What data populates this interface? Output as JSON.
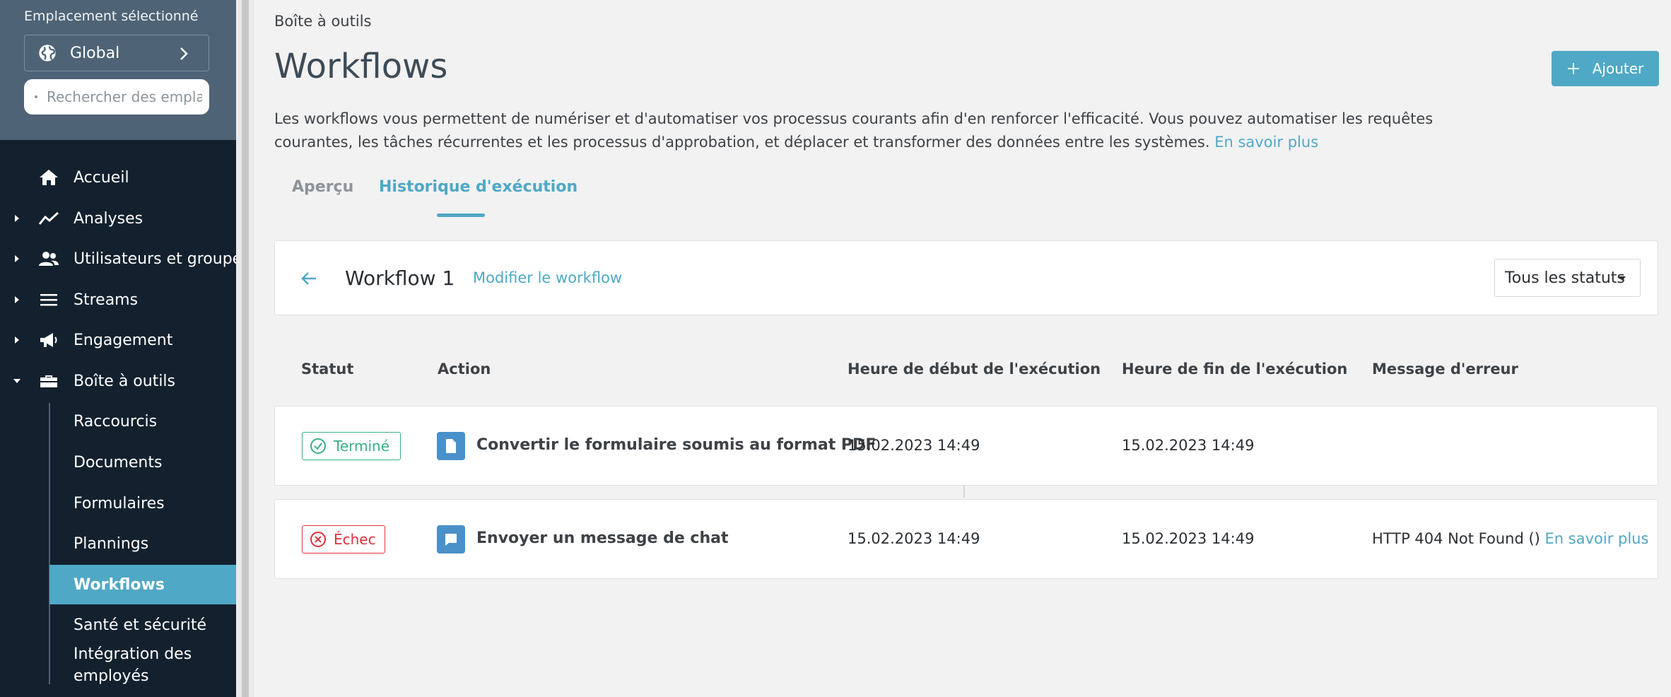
{
  "sidebar": {
    "location_label": "Emplacement sélectionné",
    "location_value": "Global",
    "search_placeholder": "Rechercher des emplacements",
    "nav": [
      {
        "label": "Accueil",
        "icon": "home-icon"
      },
      {
        "label": "Analyses",
        "icon": "chart-line-icon"
      },
      {
        "label": "Utilisateurs et groupes",
        "icon": "users-icon"
      },
      {
        "label": "Streams",
        "icon": "list-icon"
      },
      {
        "label": "Engagement",
        "icon": "megaphone-icon"
      },
      {
        "label": "Boîte à outils",
        "icon": "toolbox-icon"
      }
    ],
    "subnav": [
      {
        "label": "Raccourcis"
      },
      {
        "label": "Documents"
      },
      {
        "label": "Formulaires"
      },
      {
        "label": "Plannings"
      },
      {
        "label": "Workflows",
        "active": true
      },
      {
        "label": "Santé et sécurité"
      },
      {
        "label": "Intégration des employés"
      }
    ]
  },
  "header": {
    "breadcrumb": "Boîte à outils",
    "title": "Workflows",
    "add_label": "Ajouter",
    "description": "Les workflows vous permettent de numériser et d'automatiser vos processus courants afin d'en renforcer l'efficacité. Vous pouvez automatiser les requêtes courantes, les tâches récurrentes et les processus d'approbation, et déplacer et transformer des données entre les systèmes.",
    "learn_more": "En savoir plus"
  },
  "tabs": [
    {
      "label": "Aperçu"
    },
    {
      "label": "Historique d'exécution",
      "active": true
    }
  ],
  "workflow": {
    "name": "Workflow 1",
    "edit_label": "Modifier le workflow",
    "status_filter": "Tous les statuts"
  },
  "table": {
    "columns": [
      "Statut",
      "Action",
      "Heure de début de l'exécution",
      "Heure de fin de l'exécution",
      "Message d'erreur"
    ],
    "rows": [
      {
        "status": "Terminé",
        "action": "Convertir le formulaire soumis au format PDF",
        "action_icon": "document-icon",
        "start": "15.02.2023 14:49",
        "end": "15.02.2023 14:49",
        "error": "",
        "error_link": ""
      },
      {
        "status": "Échec",
        "action": "Envoyer un message de chat",
        "action_icon": "chat-icon",
        "start": "15.02.2023 14:49",
        "end": "15.02.2023 14:49",
        "error": "HTTP 404 Not Found ()",
        "error_link": "En savoir plus"
      }
    ]
  },
  "colors": {
    "accent": "#4fa8c5",
    "sidebar_bg": "#13212f",
    "success": "#3aae88",
    "error": "#e0303d"
  }
}
